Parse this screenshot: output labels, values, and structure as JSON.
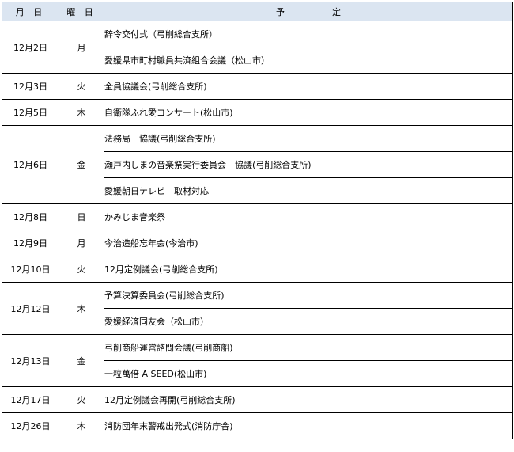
{
  "headers": {
    "date": "月 日",
    "day": "曜 日",
    "plan_1": "予",
    "plan_2": "定"
  },
  "rows": [
    {
      "date": "12月2日",
      "day": "月",
      "items": [
        "辞令交付式（弓削総合支所）",
        "愛媛県市町村職員共済組合会議（松山市）"
      ]
    },
    {
      "date": "12月3日",
      "day": "火",
      "items": [
        "全員協議会(弓削総合支所)"
      ]
    },
    {
      "date": "12月5日",
      "day": "木",
      "items": [
        "自衛隊ふれ愛コンサート(松山市)"
      ]
    },
    {
      "date": "12月6日",
      "day": "金",
      "items": [
        "法務局　協議(弓削総合支所)",
        "瀬戸内しまの音楽祭実行委員会　協議(弓削総合支所)",
        "愛媛朝日テレビ　取材対応"
      ]
    },
    {
      "date": "12月8日",
      "day": "日",
      "items": [
        "かみじま音楽祭"
      ]
    },
    {
      "date": "12月9日",
      "day": "月",
      "items": [
        "今治造船忘年会(今治市)"
      ]
    },
    {
      "date": "12月10日",
      "day": "火",
      "items": [
        "12月定例議会(弓削総合支所)"
      ]
    },
    {
      "date": "12月12日",
      "day": "木",
      "items": [
        "予算決算委員会(弓削総合支所)",
        "愛媛経済同友会（松山市）"
      ]
    },
    {
      "date": "12月13日",
      "day": "金",
      "items": [
        "弓削商船運営諮問会議(弓削商船)",
        "一粒萬倍 A SEED(松山市)"
      ]
    },
    {
      "date": "12月17日",
      "day": "火",
      "items": [
        "12月定例議会再開(弓削総合支所)"
      ]
    },
    {
      "date": "12月26日",
      "day": "木",
      "items": [
        "消防団年末警戒出発式(消防庁舎)"
      ]
    }
  ]
}
